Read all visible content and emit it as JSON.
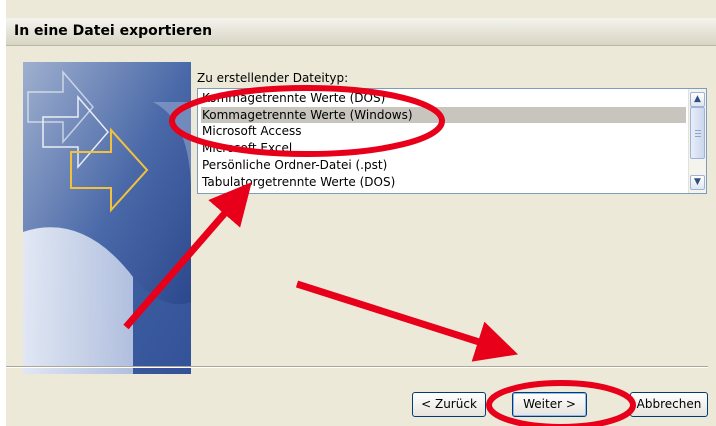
{
  "dialog": {
    "title": "In eine Datei exportieren",
    "prompt_label": "Zu erstellender Dateityp:"
  },
  "file_types": [
    "Kommagetrennte Werte (DOS)",
    "Kommagetrennte Werte (Windows)",
    "Microsoft Access",
    "Microsoft Excel",
    "Persönliche Ordner-Datei (.pst)",
    "Tabulatorgetrennte Werte (DOS)"
  ],
  "selected_index": 1,
  "buttons": {
    "back": "< Zurück",
    "next": "Weiter >",
    "cancel": "Abbrechen"
  },
  "annotation_color": "#e8001a"
}
